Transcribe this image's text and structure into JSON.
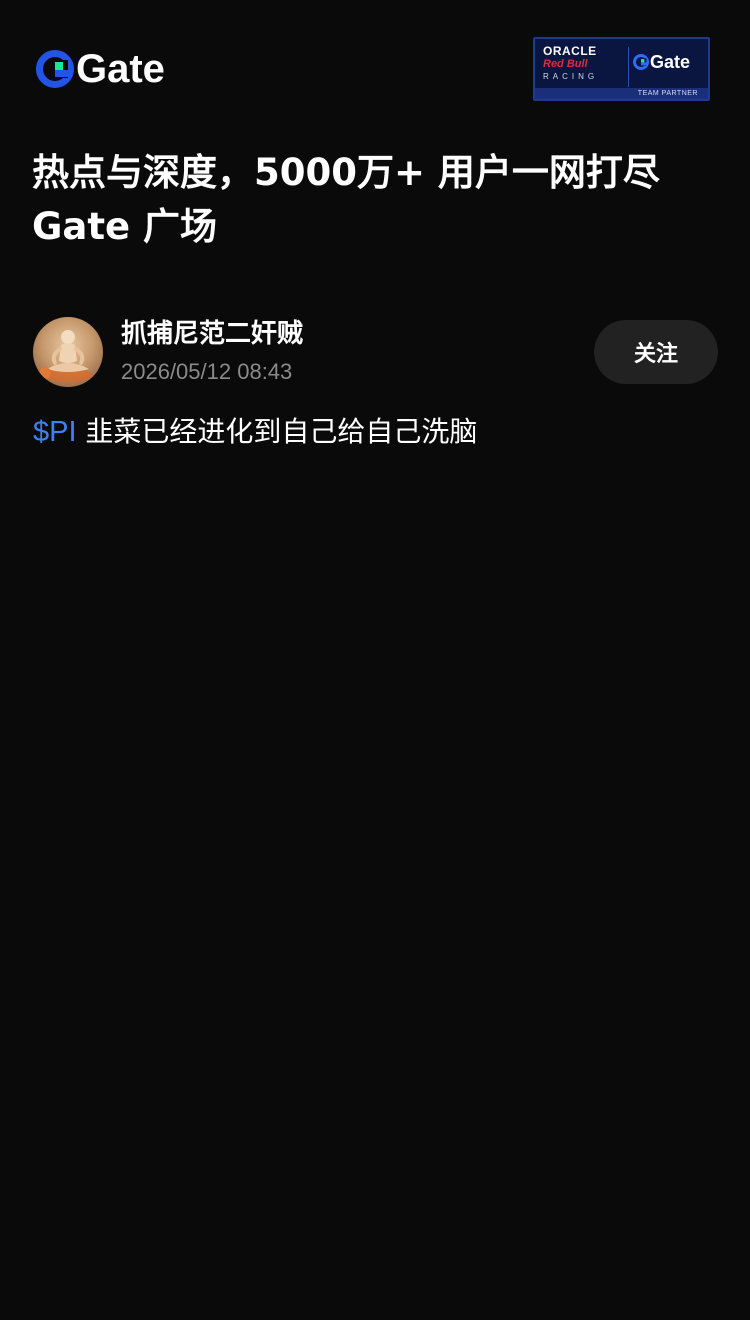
{
  "header": {
    "logo_text": "Gate",
    "partner_badge": {
      "line1": "ORACLE",
      "line2": "Red Bull",
      "line3": "RACING",
      "brand": "Gate",
      "footer": "TEAM PARTNER"
    }
  },
  "headline": {
    "line1": "热点与深度，5000万+ 用户一网打尽",
    "line2": "Gate 广场"
  },
  "post": {
    "author_name": "抓捕尼范二奸贼",
    "timestamp": "2026/05/12 08:43",
    "follow_label": "关注",
    "ticker": "$PI",
    "text": " 韭菜已经进化到自己给自己洗脑"
  },
  "colors": {
    "background": "#0a0a0a",
    "brand_blue": "#2354e6",
    "brand_green": "#17e6a1",
    "ticker_blue": "#3b82f6",
    "muted_text": "#8a8a8a",
    "follow_button_bg": "#222222"
  },
  "icons": {
    "logo": "gate-logo-icon",
    "avatar": "meditation-figure-avatar"
  }
}
